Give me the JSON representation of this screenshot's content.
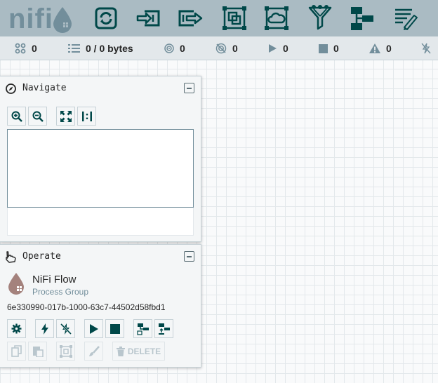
{
  "header": {
    "logo_text": "nifi",
    "tools": [
      {
        "name": "processor-tool",
        "icon": "processor-icon"
      },
      {
        "name": "input-port-tool",
        "icon": "input-port-icon"
      },
      {
        "name": "output-port-tool",
        "icon": "output-port-icon"
      },
      {
        "name": "process-group-tool",
        "icon": "process-group-icon"
      },
      {
        "name": "remote-process-group-tool",
        "icon": "remote-process-group-icon"
      },
      {
        "name": "funnel-tool",
        "icon": "funnel-icon"
      },
      {
        "name": "template-tool",
        "icon": "template-icon"
      },
      {
        "name": "label-tool",
        "icon": "label-icon"
      }
    ],
    "colors": {
      "bar": "#aabbc3",
      "icon": "#004849",
      "logo": "#728e9b"
    }
  },
  "status": {
    "active_threads": "0",
    "queued": "0 / 0 bytes",
    "transmitting": "0",
    "not_transmitting": "0",
    "running": "0",
    "stopped": "0",
    "invalid": "0"
  },
  "navigate": {
    "title": "Navigate",
    "buttons": [
      "zoom-in",
      "zoom-out",
      "fit",
      "actual-size"
    ]
  },
  "operate": {
    "title": "Operate",
    "component_name": "NiFi Flow",
    "component_type": "Process Group",
    "component_id": "6e330990-017b-1000-63c7-44502d58fbd1",
    "delete_label": "DELETE"
  }
}
